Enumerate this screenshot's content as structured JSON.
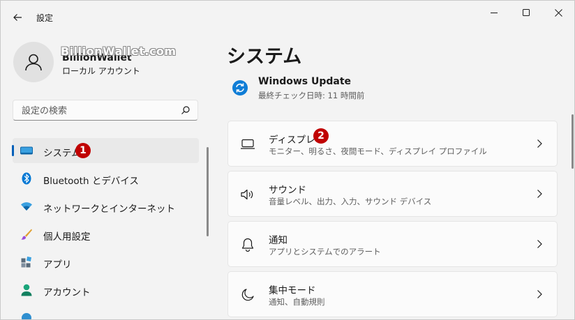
{
  "titlebar": {
    "app_title": "設定"
  },
  "user": {
    "name": "BillionWallet",
    "account_type": "ローカル アカウント",
    "watermark": "BillionWallet.com"
  },
  "search": {
    "placeholder": "設定の検索",
    "value": ""
  },
  "nav": {
    "items": [
      {
        "label": "システム",
        "icon": "system-icon",
        "active": true,
        "badge": "1"
      },
      {
        "label": "Bluetooth とデバイス",
        "icon": "bluetooth-icon"
      },
      {
        "label": "ネットワークとインターネット",
        "icon": "network-icon"
      },
      {
        "label": "個人用設定",
        "icon": "brush-icon"
      },
      {
        "label": "アプリ",
        "icon": "apps-icon"
      },
      {
        "label": "アカウント",
        "icon": "account-icon"
      }
    ]
  },
  "main": {
    "title": "システム",
    "windows_update": {
      "title": "Windows Update",
      "subtitle": "最終チェック日時: 11 時間前"
    },
    "cards": [
      {
        "title": "ディスプレイ",
        "desc": "モニター、明るさ、夜間モード、ディスプレイ プロファイル",
        "icon": "display-icon",
        "badge": "2"
      },
      {
        "title": "サウンド",
        "desc": "音量レベル、出力、入力、サウンド デバイス",
        "icon": "sound-icon"
      },
      {
        "title": "通知",
        "desc": "アプリとシステムでのアラート",
        "icon": "bell-icon"
      },
      {
        "title": "集中モード",
        "desc": "通知、自動規則",
        "icon": "moon-icon"
      }
    ]
  },
  "colors": {
    "accent": "#005fb8",
    "badge": "#c00000",
    "background": "#f3f3f3",
    "card": "#fbfbfb"
  }
}
